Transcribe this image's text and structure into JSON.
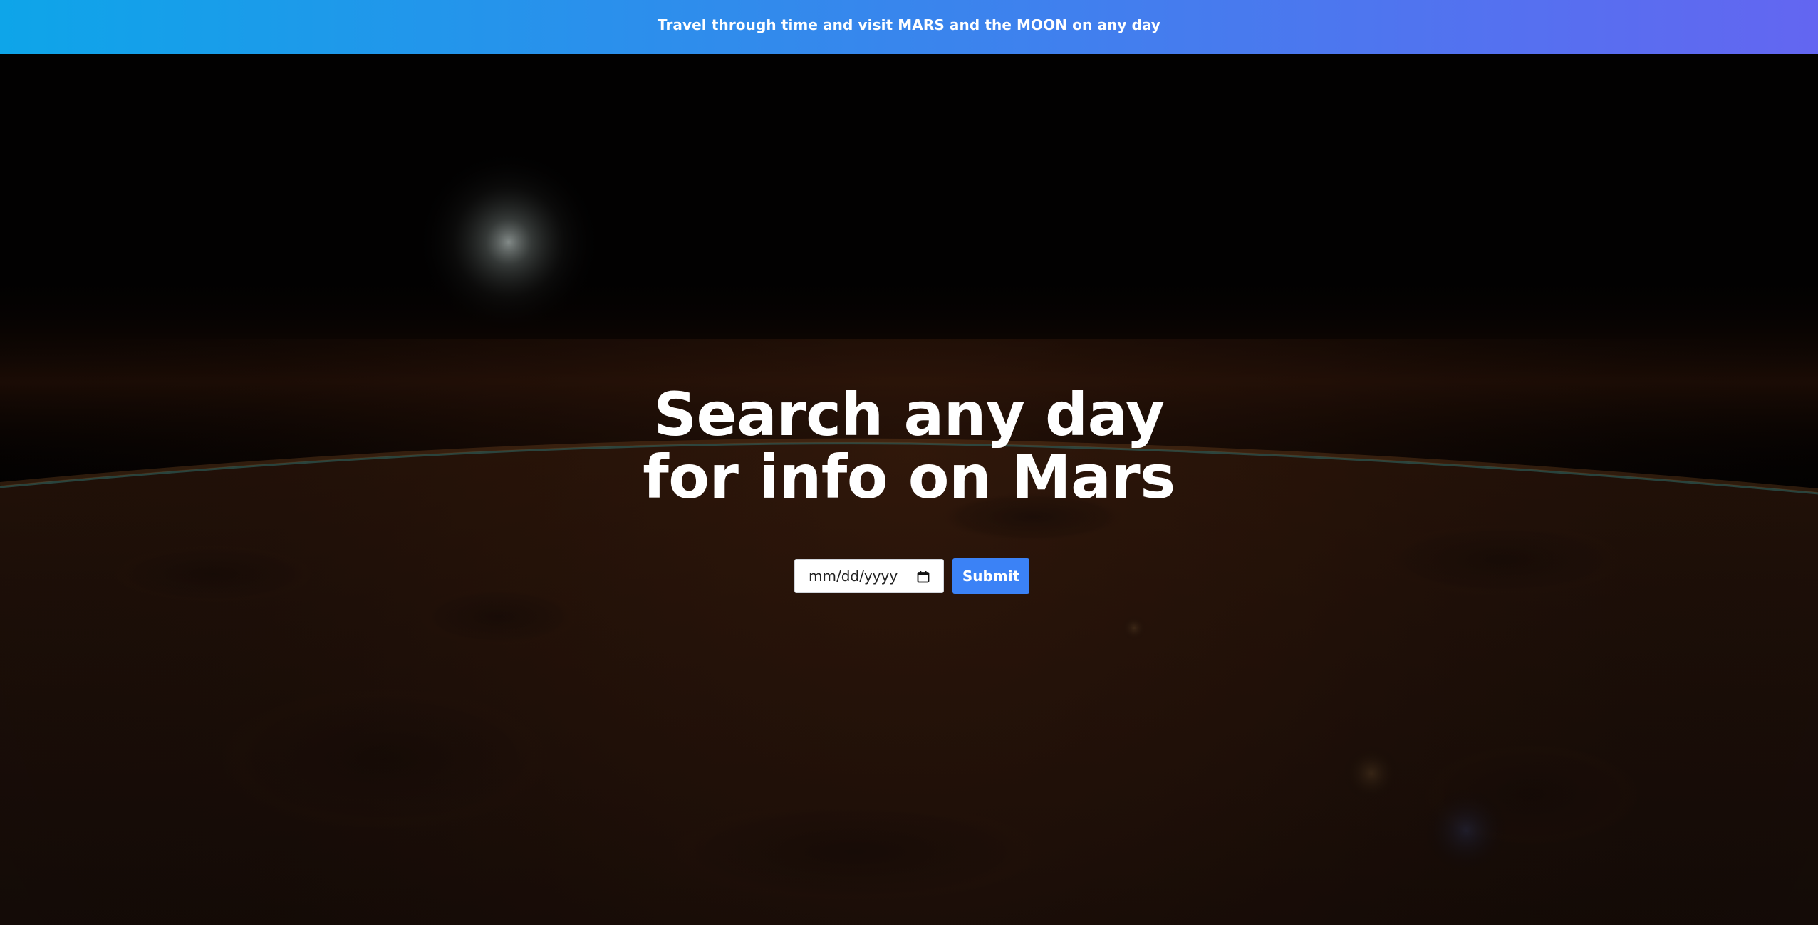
{
  "banner": {
    "text": "Travel through time and visit MARS and the MOON on any day",
    "gradient_start": "#0ea5e9",
    "gradient_end": "#6366f1"
  },
  "hero": {
    "headline_line1": "Search any day",
    "headline_line2": "for info on Mars",
    "background_description_icon": "mars-surface-image"
  },
  "search_form": {
    "date_placeholder": "mm/dd/yyyy",
    "date_icon": "calendar-icon",
    "submit_label": "Submit",
    "submit_color": "#3b82f6"
  }
}
